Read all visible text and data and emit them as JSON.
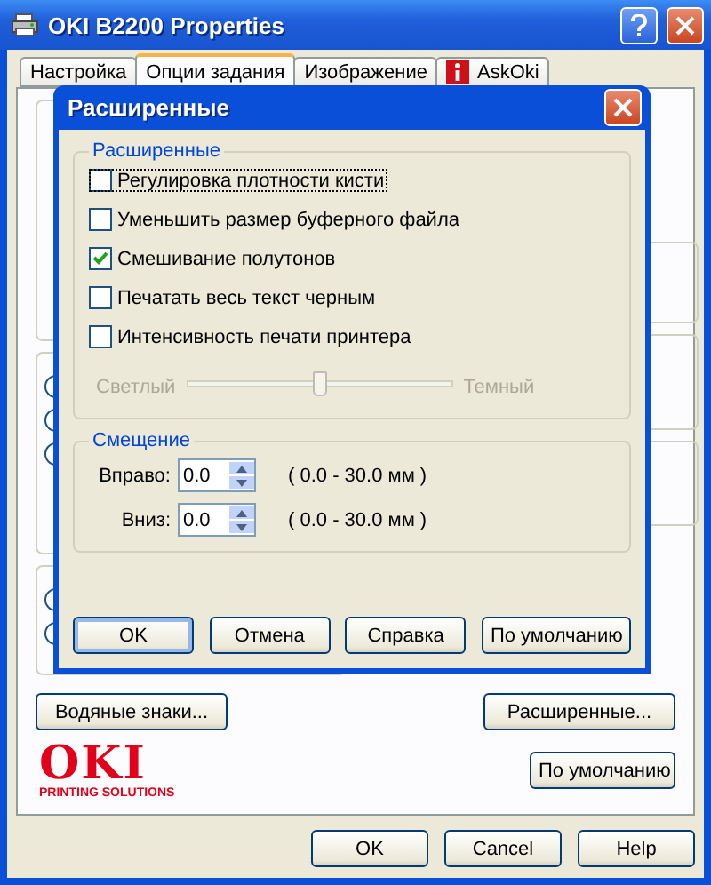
{
  "window": {
    "title": "OKI B2200 Properties"
  },
  "tabs": [
    {
      "label": "Настройка",
      "selected": false,
      "kind": "plain"
    },
    {
      "label": "Опции задания",
      "selected": true,
      "kind": "plain"
    },
    {
      "label": "Изображение",
      "selected": false,
      "kind": "plain"
    },
    {
      "label": "AskOki",
      "selected": false,
      "kind": "info"
    }
  ],
  "page": {
    "buttons": [
      "Водяные знаки...",
      "Расширенные..."
    ],
    "default_button": "По умолчанию",
    "logo": {
      "name": "OKI",
      "tagline": "PRINTING SOLUTIONS"
    }
  },
  "dialog": {
    "title": "Расширенные",
    "advanced_group": {
      "title": "Расширенные",
      "options": [
        {
          "label": "Регулировка плотности кисти",
          "checked": false,
          "focused": true
        },
        {
          "label": "Уменьшить размер буферного файла",
          "checked": false,
          "focused": false
        },
        {
          "label": "Смешивание полутонов",
          "checked": true,
          "focused": false
        },
        {
          "label": "Печатать весь текст черным",
          "checked": false,
          "focused": false
        },
        {
          "label": "Интенсивность печати принтера",
          "checked": false,
          "focused": false
        }
      ],
      "slider": {
        "min_label": "Светлый",
        "max_label": "Темный",
        "level": 0.5,
        "disabled": true
      }
    },
    "offset_group": {
      "title": "Смещение",
      "fields": [
        {
          "label": "Вправо:",
          "value": "0.0",
          "range": "( 0.0 - 30.0 мм )"
        },
        {
          "label": "Вниз:",
          "value": "0.0",
          "range": "( 0.0 - 30.0 мм )"
        }
      ]
    },
    "buttons": [
      {
        "label": "OK",
        "default": true
      },
      {
        "label": "Отмена",
        "default": false
      },
      {
        "label": "Справка",
        "default": false
      },
      {
        "label": "По умолчанию",
        "default": false
      }
    ]
  },
  "footer_buttons": [
    "OK",
    "Cancel",
    "Help"
  ]
}
